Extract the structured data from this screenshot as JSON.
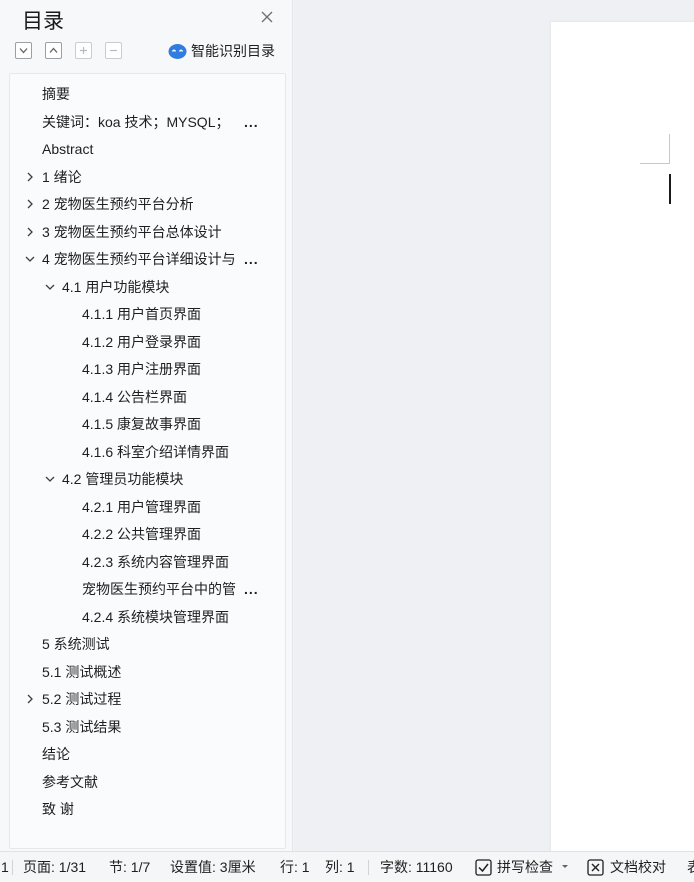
{
  "toc_panel": {
    "title": "目录",
    "toolbar": {
      "smart_toc_label": "智能识别目录"
    },
    "items": [
      {
        "label": "摘要",
        "level": 0,
        "toggle": "none"
      },
      {
        "label": "关键词：koa 技术；MYSQL；",
        "level": 0,
        "toggle": "none",
        "truncated": true
      },
      {
        "label": "Abstract",
        "level": 0,
        "toggle": "none"
      },
      {
        "label": "1  绪论",
        "level": 0,
        "toggle": "collapsed"
      },
      {
        "label": "2  宠物医生预约平台分析",
        "level": 0,
        "toggle": "collapsed"
      },
      {
        "label": "3  宠物医生预约平台总体设计",
        "level": 0,
        "toggle": "collapsed"
      },
      {
        "label": "4  宠物医生预约平台详细设计与",
        "level": 0,
        "toggle": "expanded",
        "truncated": true
      },
      {
        "label": "4.1 用户功能模块",
        "level": 1,
        "toggle": "expanded"
      },
      {
        "label": "4.1.1  用户首页界面",
        "level": 2,
        "toggle": "none"
      },
      {
        "label": "4.1.2 用户登录界面",
        "level": 2,
        "toggle": "none"
      },
      {
        "label": "4.1.3 用户注册界面",
        "level": 2,
        "toggle": "none"
      },
      {
        "label": "4.1.4 公告栏界面",
        "level": 2,
        "toggle": "none"
      },
      {
        "label": "4.1.5 康复故事界面",
        "level": 2,
        "toggle": "none"
      },
      {
        "label": "4.1.6 科室介绍详情界面",
        "level": 2,
        "toggle": "none"
      },
      {
        "label": "4.2 管理员功能模块",
        "level": 1,
        "toggle": "expanded"
      },
      {
        "label": "4.2.1  用户管理界面",
        "level": 2,
        "toggle": "none"
      },
      {
        "label": "4.2.2 公共管理界面",
        "level": 2,
        "toggle": "none"
      },
      {
        "label": "4.2.3 系统内容管理界面",
        "level": 2,
        "toggle": "none"
      },
      {
        "label": "宠物医生预约平台中的管",
        "level": 2,
        "toggle": "none",
        "truncated": true
      },
      {
        "label": "4.2.4 系统模块管理界面",
        "level": 2,
        "toggle": "none"
      },
      {
        "label": "5 系统测试",
        "level": 0,
        "toggle": "none"
      },
      {
        "label": "5.1 测试概述",
        "level": 0,
        "toggle": "none"
      },
      {
        "label": "5.2 测试过程",
        "level": 0,
        "toggle": "collapsed"
      },
      {
        "label": "5.3 测试结果",
        "level": 0,
        "toggle": "none"
      },
      {
        "label": "结论",
        "level": 0,
        "toggle": "none"
      },
      {
        "label": "参考文献",
        "level": 0,
        "toggle": "none"
      },
      {
        "label": "致    谢",
        "level": 0,
        "toggle": "none"
      }
    ],
    "ellipsis": "..."
  },
  "status_bar": {
    "section_prefix": "1",
    "page": "页面: 1/31",
    "section": "节: 1/7",
    "setting": "设置值: 3厘米",
    "row": "行: 1",
    "col": "列: 1",
    "word_count": "字数: 11160",
    "spell_check": "拼写检查",
    "doc_proof": "文档校对",
    "overflow_text": "表"
  },
  "colors": {
    "accent": "#2f7de1",
    "icon_gray": "#5f6368"
  }
}
